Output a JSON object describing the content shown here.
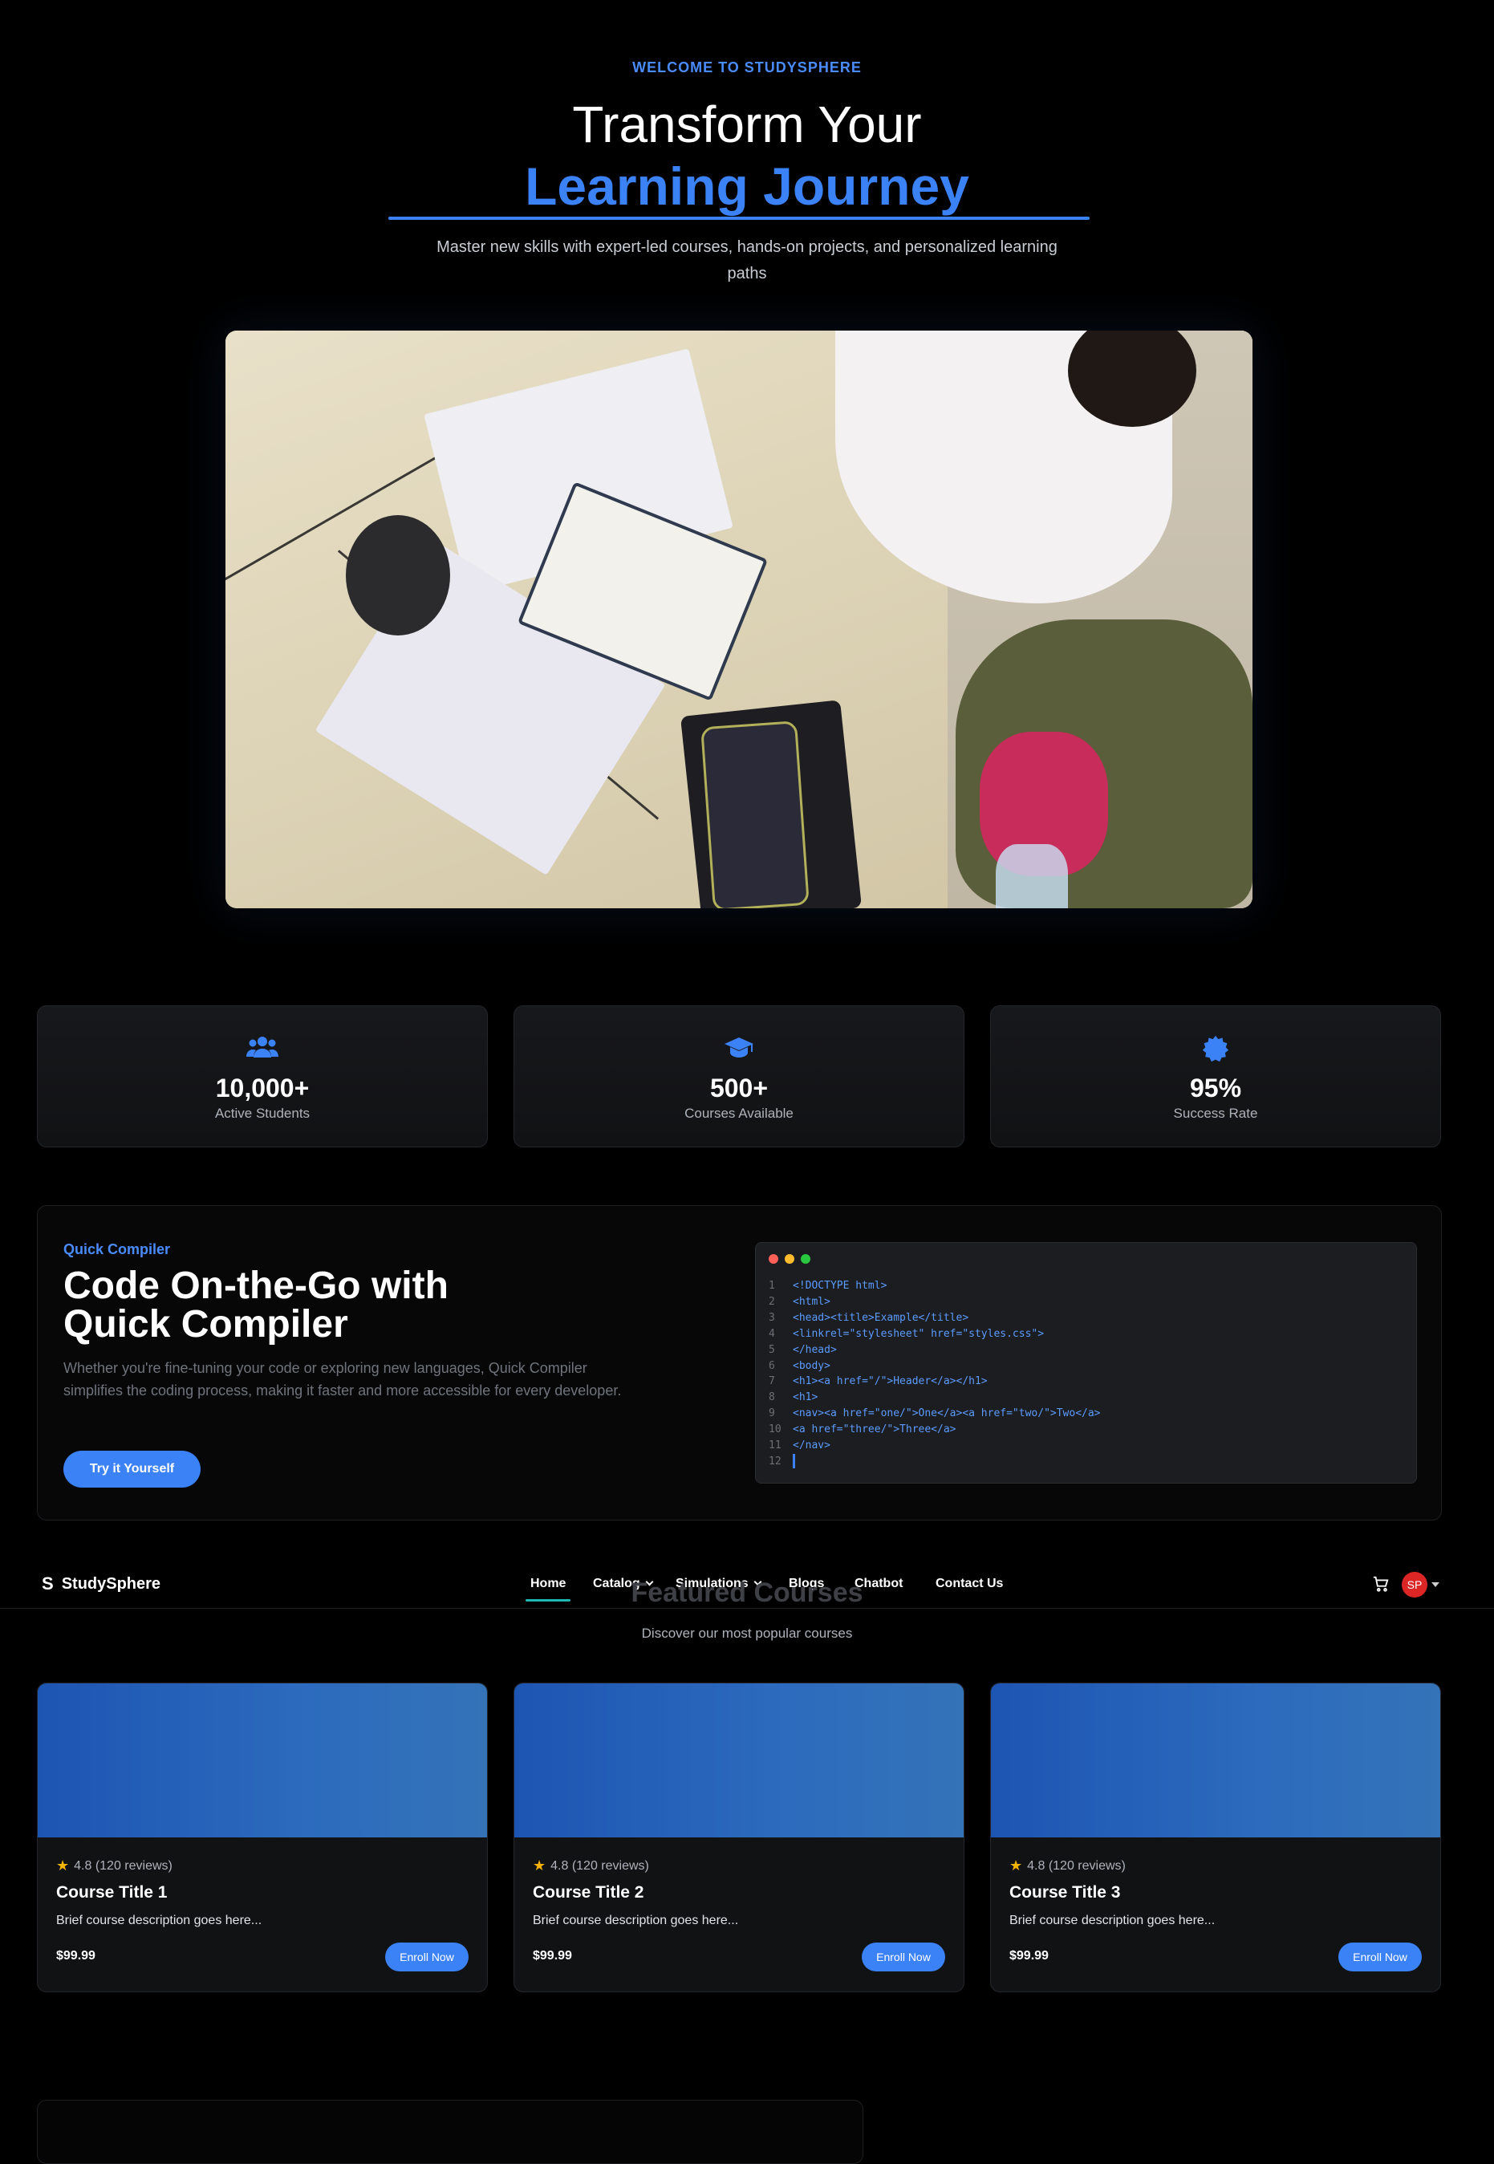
{
  "hero": {
    "eyebrow": "WELCOME TO STUDYSPHERE",
    "title_line1": "Transform Your",
    "title_line2": "Learning Journey",
    "subtitle": "Master new skills with expert-led courses, hands-on projects, and personalized learning paths"
  },
  "stats": [
    {
      "icon": "users-icon",
      "value": "10,000+",
      "label": "Active Students"
    },
    {
      "icon": "graduation-cap-icon",
      "value": "500+",
      "label": "Courses Available"
    },
    {
      "icon": "award-badge-icon",
      "value": "95%",
      "label": "Success Rate"
    }
  ],
  "compiler": {
    "eyebrow": "Quick Compiler",
    "title": "Code On-the-Go with Quick Compiler",
    "description": "Whether you're fine-tuning your code or exploring new languages, Quick Compiler simplifies the coding process, making it faster and more accessible for every developer.",
    "button": "Try it Yourself",
    "code_lines": [
      {
        "n": "1",
        "text": "<!DOCTYPE html>"
      },
      {
        "n": "2",
        "text": "<html>"
      },
      {
        "n": "3",
        "text": "<head><title>Example</title>"
      },
      {
        "n": "4",
        "text": "<linkrel=\"stylesheet\" href=\"styles.css\">"
      },
      {
        "n": "5",
        "text": "</head>"
      },
      {
        "n": "6",
        "text": "<body>"
      },
      {
        "n": "7",
        "text": "<h1><a href=\"/\">Header</a></h1>"
      },
      {
        "n": "8",
        "text": "<h1>"
      },
      {
        "n": "9",
        "text": "<nav><a href=\"one/\">One</a><a href=\"two/\">Two</a>"
      },
      {
        "n": "10",
        "text": "<a href=\"three/\">Three</a>"
      },
      {
        "n": "11",
        "text": "</nav>"
      },
      {
        "n": "12",
        "text": ""
      }
    ],
    "dot_colors": [
      "#ff5f57",
      "#febc2e",
      "#28c840"
    ]
  },
  "navbar": {
    "logo_mark": "S",
    "logo_text": "StudySphere",
    "links": [
      "Home",
      "Catalog",
      "Simulations",
      "Blogs",
      "Chatbot",
      "Contact Us"
    ],
    "avatar_initials": "SP"
  },
  "featured": {
    "title": "Featured Courses",
    "subtitle": "Discover our most popular courses"
  },
  "courses": [
    {
      "rating": "4.8 (120 reviews)",
      "title": "Course Title 1",
      "description": "Brief course description goes here...",
      "price": "$99.99",
      "button": "Enroll Now"
    },
    {
      "rating": "4.8 (120 reviews)",
      "title": "Course Title 2",
      "description": "Brief course description goes here...",
      "price": "$99.99",
      "button": "Enroll Now"
    },
    {
      "rating": "4.8 (120 reviews)",
      "title": "Course Title 3",
      "description": "Brief course description goes here...",
      "price": "$99.99",
      "button": "Enroll Now"
    }
  ],
  "colors": {
    "accent": "#3b82f6",
    "active_underline": "#1fb7b0",
    "avatar": "#dc2626",
    "star": "#f5b301"
  }
}
